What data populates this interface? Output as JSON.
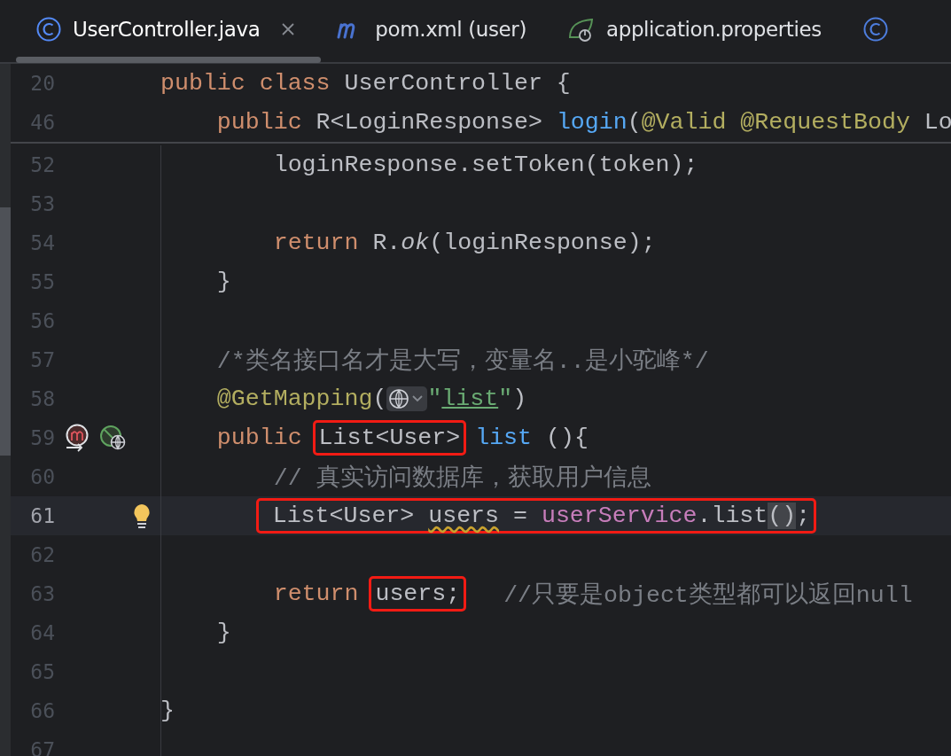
{
  "tabs": [
    {
      "kind": "class",
      "label": "UserController.java",
      "selected": true,
      "closable": true
    },
    {
      "kind": "maven",
      "label": "pom.xml (user)",
      "selected": false,
      "closable": false
    },
    {
      "kind": "spring-properties",
      "label": "application.properties",
      "selected": false,
      "closable": false
    },
    {
      "kind": "class",
      "selected": false,
      "closable": false
    }
  ],
  "sticky_lines": [
    {
      "number": "20",
      "current": false,
      "segments": [
        {
          "boxed": false,
          "tokens": [
            {
              "kind": "kw",
              "text": "public"
            },
            {
              "kind": "kw",
              "text": " class"
            },
            {
              "kind": "plain",
              "text": " UserController {"
            }
          ]
        }
      ]
    },
    {
      "number": "46",
      "current": false,
      "segments": [
        {
          "boxed": false,
          "tokens": [
            {
              "kind": "kw",
              "text": "    public"
            },
            {
              "kind": "plain",
              "text": " R<LoginResponse> "
            },
            {
              "kind": "method",
              "text": "login"
            },
            {
              "kind": "plain",
              "text": "("
            },
            {
              "kind": "annotation",
              "text": "@Valid"
            },
            {
              "kind": "annotation",
              "text": " @RequestBody"
            },
            {
              "kind": "plain",
              "text": " Lo"
            }
          ]
        }
      ]
    }
  ],
  "lines": [
    {
      "number": "52",
      "current": false,
      "segments": [
        {
          "boxed": false,
          "tokens": [
            {
              "kind": "plain",
              "text": "        loginResponse.setToken(token);"
            }
          ]
        }
      ]
    },
    {
      "number": "53",
      "current": false
    },
    {
      "number": "54",
      "current": false,
      "segments": [
        {
          "boxed": false,
          "tokens": [
            {
              "kind": "kw",
              "text": "        return"
            },
            {
              "kind": "plain",
              "text": " R."
            },
            {
              "kind": "static",
              "text": "ok"
            },
            {
              "kind": "plain",
              "text": "(loginResponse);"
            }
          ]
        }
      ]
    },
    {
      "number": "55",
      "current": false,
      "segments": [
        {
          "boxed": false,
          "tokens": [
            {
              "kind": "plain",
              "text": "    }"
            }
          ]
        }
      ]
    },
    {
      "number": "56",
      "current": false
    },
    {
      "number": "57",
      "current": false,
      "segments": [
        {
          "boxed": false,
          "tokens": [
            {
              "kind": "comment",
              "text": "    /*类名接口名才是大写，变量名..是小驼峰*/"
            }
          ]
        }
      ]
    },
    {
      "number": "58",
      "current": false,
      "segments": [
        {
          "boxed": false,
          "tokens": [
            {
              "kind": "annotation",
              "text": "    @GetMapping"
            },
            {
              "kind": "plain",
              "text": "("
            },
            {
              "kind": "hint"
            },
            {
              "kind": "string",
              "text": "\""
            },
            {
              "kind": "link",
              "text": "list"
            },
            {
              "kind": "string",
              "text": "\""
            },
            {
              "kind": "plain",
              "text": ")"
            }
          ]
        }
      ]
    },
    {
      "number": "59",
      "current": false,
      "gutter": [
        {
          "kind": "implementing-method"
        },
        {
          "kind": "web-endpoint"
        }
      ],
      "segments": [
        {
          "boxed": false,
          "tokens": [
            {
              "kind": "kw",
              "text": "    public"
            }
          ]
        },
        {
          "boxed": true,
          "tokens": [
            {
              "kind": "plain",
              "text": "List<User>"
            }
          ]
        },
        {
          "boxed": false,
          "tokens": [
            {
              "kind": "method",
              "text": "list"
            },
            {
              "kind": "plain",
              "text": " (){"
            }
          ]
        }
      ]
    },
    {
      "number": "60",
      "current": false,
      "segments": [
        {
          "boxed": false,
          "tokens": [
            {
              "kind": "comment",
              "text": "        // 真实访问数据库，获取用户信息"
            }
          ]
        }
      ]
    },
    {
      "number": "61",
      "current": true,
      "gutter": [
        {
          "kind": "bulb"
        }
      ],
      "segments": [
        {
          "boxed": true,
          "tokens": [
            {
              "kind": "plain",
              "text": "        List<User> "
            },
            {
              "kind": "warning",
              "text": "users"
            },
            {
              "kind": "plain",
              "text": " = "
            },
            {
              "kind": "field",
              "text": "userService"
            },
            {
              "kind": "plain",
              "text": ".list"
            },
            {
              "kind": "matched",
              "text": "()"
            },
            {
              "kind": "plain",
              "text": ";"
            }
          ]
        }
      ]
    },
    {
      "number": "62",
      "current": false
    },
    {
      "number": "63",
      "current": false,
      "segments": [
        {
          "boxed": false,
          "tokens": [
            {
              "kind": "kw",
              "text": "        return"
            }
          ]
        },
        {
          "boxed": true,
          "tokens": [
            {
              "kind": "plain",
              "text": "users;"
            }
          ]
        },
        {
          "boxed": false,
          "tokens": [
            {
              "kind": "comment",
              "text": "  //只要是object类型都可以返回null"
            }
          ]
        }
      ]
    },
    {
      "number": "64",
      "current": false,
      "segments": [
        {
          "boxed": false,
          "tokens": [
            {
              "kind": "plain",
              "text": "    }"
            }
          ]
        }
      ]
    },
    {
      "number": "65",
      "current": false
    },
    {
      "number": "66",
      "current": false,
      "segments": [
        {
          "boxed": false,
          "tokens": [
            {
              "kind": "plain",
              "text": "}"
            }
          ]
        }
      ]
    },
    {
      "number": "67",
      "current": false
    }
  ]
}
